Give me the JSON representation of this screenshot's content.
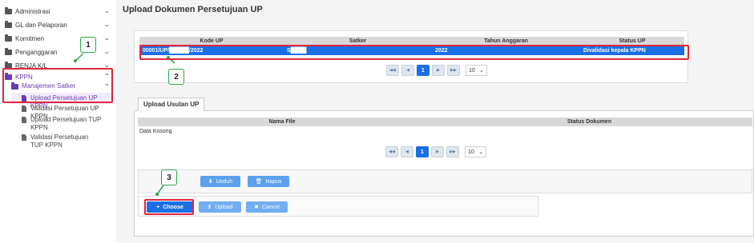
{
  "sidebar": {
    "items": [
      {
        "label": "Administrasi"
      },
      {
        "label": "GL dan Pelaporan"
      },
      {
        "label": "Komitmen"
      },
      {
        "label": "Penganggaran"
      },
      {
        "label": "RENJA K/L"
      },
      {
        "label": "KPPN"
      }
    ],
    "submenu": {
      "label": "Manajemen Satker"
    },
    "leaves": [
      {
        "label": "Upload Persetujuan UP KPPN"
      },
      {
        "label": "Validasi Persetujuan UP KPPN"
      },
      {
        "label": "Upload Persetujuan TUP KPPN"
      },
      {
        "label": "Validasi Persetujuan TUP KPPN"
      }
    ]
  },
  "page": {
    "title": "Upload Dokumen Persetujuan UP"
  },
  "up_table": {
    "columns": [
      "Kode UP",
      "Satker",
      "Tahun Anggaran",
      "Status UP"
    ],
    "rows": [
      {
        "kode": "00001/UP/█████/2022",
        "satker": "S████",
        "tahun": "2022",
        "status": "Divalidasi kepala KPPN"
      }
    ],
    "pager": {
      "current_page": "1",
      "page_size": "10"
    }
  },
  "upload_section": {
    "tab_label": "Upload Usulan UP",
    "columns": [
      "Nama File",
      "Status Dokumen"
    ],
    "empty_text": "Data Kosong",
    "pager": {
      "current_page": "1",
      "page_size": "10"
    },
    "unduh_label": "Unduh",
    "hapus_label": "Hapus",
    "choose_label": "Choose",
    "upload_label": "Upload",
    "cancel_label": "Cancel"
  },
  "annotations": {
    "n1": "1",
    "n2": "2",
    "n3": "3",
    "color_highlight": "#e0263c",
    "color_callout": "#2aa84a"
  },
  "colors": {
    "primary": "#1a6ee6",
    "button": "#5aa0ee",
    "menu_active": "#6a3ab2"
  }
}
